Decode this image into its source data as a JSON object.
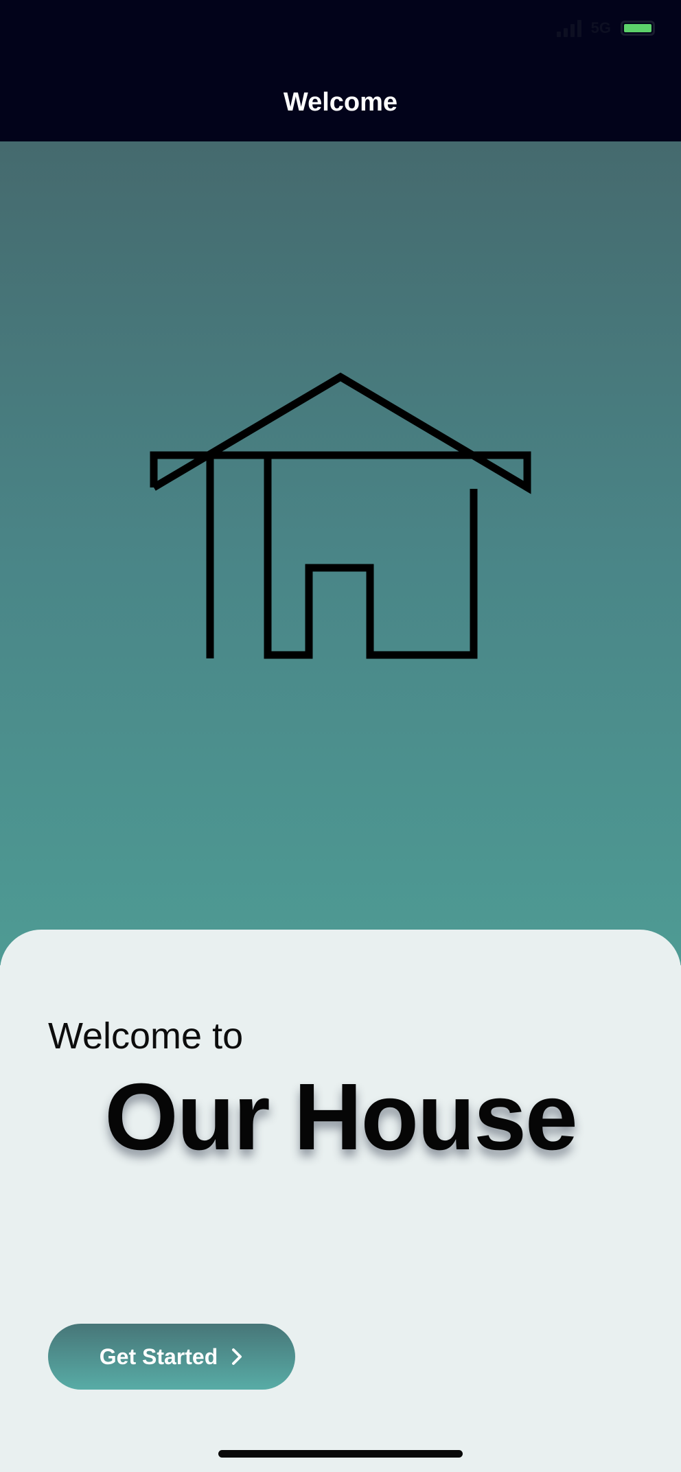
{
  "status_bar": {
    "time": "",
    "network": "5G",
    "icons": [
      "signal-icon",
      "network-icon",
      "battery-icon"
    ],
    "battery_color": "#5cd16a"
  },
  "nav": {
    "title": "Welcome"
  },
  "hero": {
    "logo_icon": "house-outline-icon",
    "gradient_top": "#456a6e",
    "gradient_bottom": "#4e9b94"
  },
  "card": {
    "welcome_text": "Welcome to",
    "brand_name": "Our House",
    "cta_label": "Get Started",
    "cta_icon": "chevron-right-icon"
  },
  "colors": {
    "nav_background": "#02031a",
    "card_background": "#e9f0f0",
    "cta_gradient_top": "#477678",
    "cta_gradient_bottom": "#58aca6"
  }
}
